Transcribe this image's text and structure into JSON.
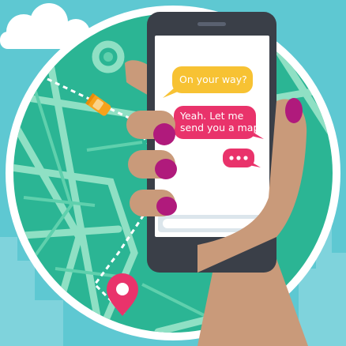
{
  "messages": [
    {
      "sender": "contact",
      "text": "On your way?",
      "color": "#f7c233"
    },
    {
      "sender": "user",
      "text_line_1": "Yeah. Let me",
      "text_line_2": "send you a map",
      "color": "#e9336b"
    },
    {
      "sender": "user",
      "typing": true,
      "color": "#e9336b"
    }
  ],
  "icons": [
    "cloud-icon",
    "car-icon",
    "map-pin-icon",
    "send-icon",
    "typing-dots-icon"
  ],
  "colors": {
    "background": "#5ec8d2",
    "map_green": "#2bb594",
    "road": "#8fe0c4",
    "phone_body": "#3a3f48",
    "screen": "#ffffff",
    "accent_pink": "#e9336b",
    "accent_yellow": "#f7c233",
    "nail_magenta": "#b01a7c",
    "skin": "#c99a7a"
  }
}
